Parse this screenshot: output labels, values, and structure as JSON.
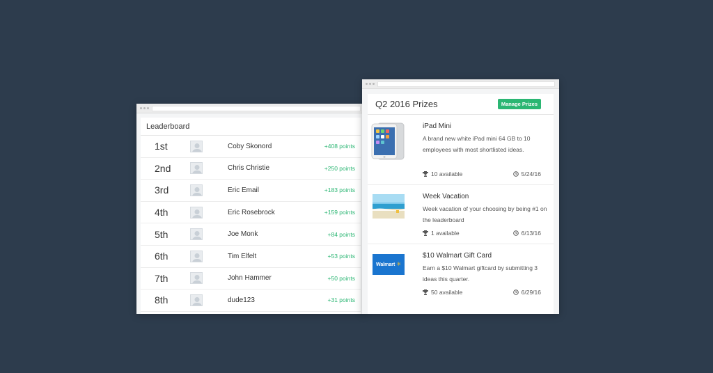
{
  "leaderboard": {
    "title": "Leaderboard",
    "rows": [
      {
        "rank": "1st",
        "name": "Coby Skonord",
        "points": "+408 points"
      },
      {
        "rank": "2nd",
        "name": "Chris Christie",
        "points": "+250 points"
      },
      {
        "rank": "3rd",
        "name": "Eric Email",
        "points": "+183 points"
      },
      {
        "rank": "4th",
        "name": "Eric Rosebrock",
        "points": "+159 points"
      },
      {
        "rank": "5th",
        "name": "Joe Monk",
        "points": "+84 points"
      },
      {
        "rank": "6th",
        "name": "Tim Elfelt",
        "points": "+53 points"
      },
      {
        "rank": "7th",
        "name": "John Hammer",
        "points": "+50 points"
      },
      {
        "rank": "8th",
        "name": "dude123",
        "points": "+31 points"
      }
    ]
  },
  "prizes": {
    "title": "Q2 2016 Prizes",
    "manage_label": "Manage Prizes",
    "items": [
      {
        "name": "iPad Mini",
        "description": "A brand new white iPad mini 64 GB to 10 employees with most shortlisted ideas.",
        "available": "10 available",
        "date": "5/24/16",
        "image": "ipad-image"
      },
      {
        "name": "Week Vacation",
        "description": "Week vacation of your choosing by being #1 on the leaderboard",
        "available": "1 available",
        "date": "6/13/16",
        "image": "beach-image"
      },
      {
        "name": "$10 Walmart Gift Card",
        "description": "Earn a $10 Walmart giftcard by submitting 3 ideas this quarter.",
        "available": "50 available",
        "date": "6/29/16",
        "image": "walmart-logo",
        "logo_text": "Walmart"
      }
    ]
  },
  "colors": {
    "background": "#2d3c4d",
    "accent_green": "#2bb673",
    "walmart_blue": "#1a75cf"
  }
}
